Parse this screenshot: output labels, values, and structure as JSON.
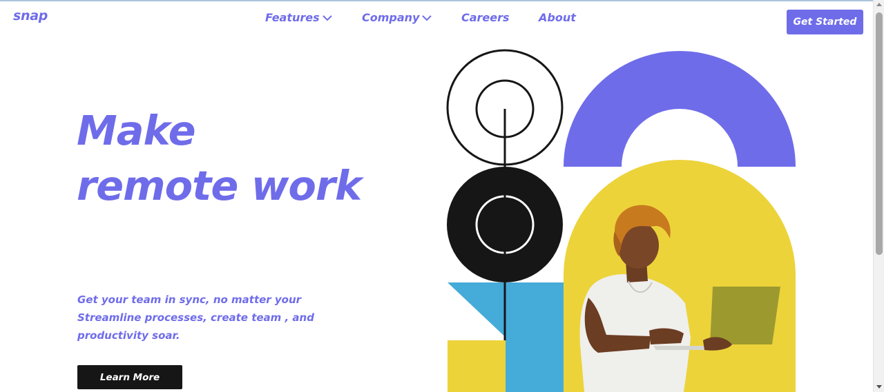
{
  "header": {
    "logo": "snap",
    "nav": [
      {
        "label": "Features",
        "has_dropdown": true
      },
      {
        "label": "Company",
        "has_dropdown": true
      },
      {
        "label": "Careers",
        "has_dropdown": false
      },
      {
        "label": "About",
        "has_dropdown": false
      }
    ],
    "cta_label": "Get Started"
  },
  "hero": {
    "title_line1": "Make",
    "title_line2": "remote work",
    "text_line1": "Get your team in sync, no matter your",
    "text_line2": "Streamline processes, create team , and",
    "text_line3": "productivity soar.",
    "button_label": "Learn More"
  },
  "colors": {
    "accent": "#6f6cea",
    "dark": "#161616",
    "yellow": "#ecd33a",
    "blue": "#45abd9",
    "white": "#ffffff"
  },
  "icons": {
    "dropdown": "chevron-down-icon"
  }
}
